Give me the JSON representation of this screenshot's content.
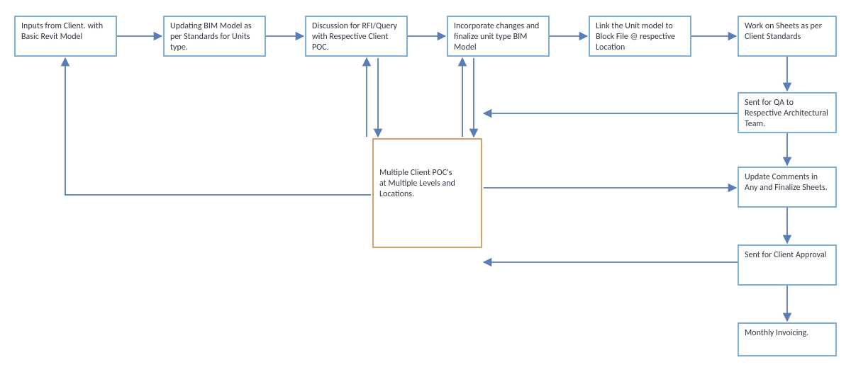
{
  "colors": {
    "boxBorder": "#7daed6",
    "centralBorder": "#d7a06a",
    "arrow": "#5a7db6"
  },
  "boxes": {
    "b1": "Inputs from Client. with Basic Revit Model",
    "b2": "Updating BIM Model as per Standards for Units type.",
    "b3": "Discussion for RFI/Query with Respective Client POC.",
    "b4": "Incorporate changes and finalize unit type BIM Model",
    "b5": "Link the Unit model to Block File @ respective Location",
    "b6": "Work on Sheets as per Client Standards",
    "b7": "Sent for QA to Respective Architectural Team.",
    "b8": "Update Comments in Any and Finalize Sheets.",
    "b9": "Sent for Client Approval",
    "b10": "Monthly Invoicing.",
    "central": "Multiple Client POC's\nat Multiple Levels and Locations."
  }
}
